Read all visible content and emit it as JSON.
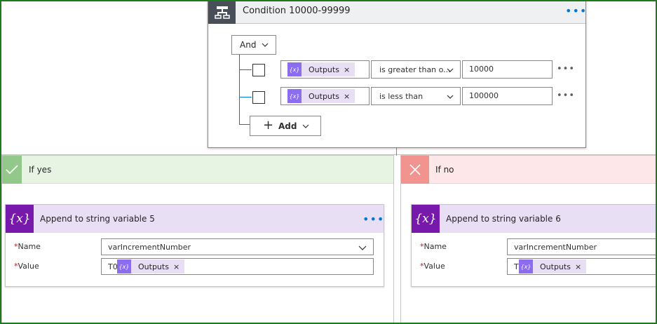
{
  "condition": {
    "title": "Condition 10000-99999",
    "operator": "And",
    "rows": [
      {
        "token": "Outputs",
        "comparison": "is greater than o...",
        "value": "10000"
      },
      {
        "token": "Outputs",
        "comparison": "is less than",
        "value": "100000"
      }
    ],
    "add_label": "Add"
  },
  "token_close": "×",
  "icons": {
    "condition": "condition-icon",
    "more": "more-options-icon",
    "check": "check-icon",
    "close": "close-icon",
    "variable": "variable-icon",
    "expression": "expression-icon",
    "chevron": "chevron-down-icon",
    "plus": "plus-icon"
  },
  "branches": {
    "yes": {
      "title": "If yes",
      "action": {
        "title": "Append to string variable 5",
        "name_label": "Name",
        "name_value": "varIncrementNumber",
        "value_label": "Value",
        "value_prefix": "T0",
        "value_token": "Outputs"
      }
    },
    "no": {
      "title": "If no",
      "action": {
        "title": "Append to string variable 6",
        "name_label": "Name",
        "name_value": "varIncrementNumber",
        "value_label": "Value",
        "value_prefix": "T",
        "value_token": "Outputs"
      }
    }
  },
  "required_marker": "*",
  "colors": {
    "accent_blue": "#0078d4",
    "condition_header": "#484f58",
    "variable_purple": "#7719aa",
    "token_purple": "#8c6cf0",
    "yes_green": "#92c98a",
    "no_red": "#f1938e",
    "frame_green": "#1f7a1f"
  }
}
